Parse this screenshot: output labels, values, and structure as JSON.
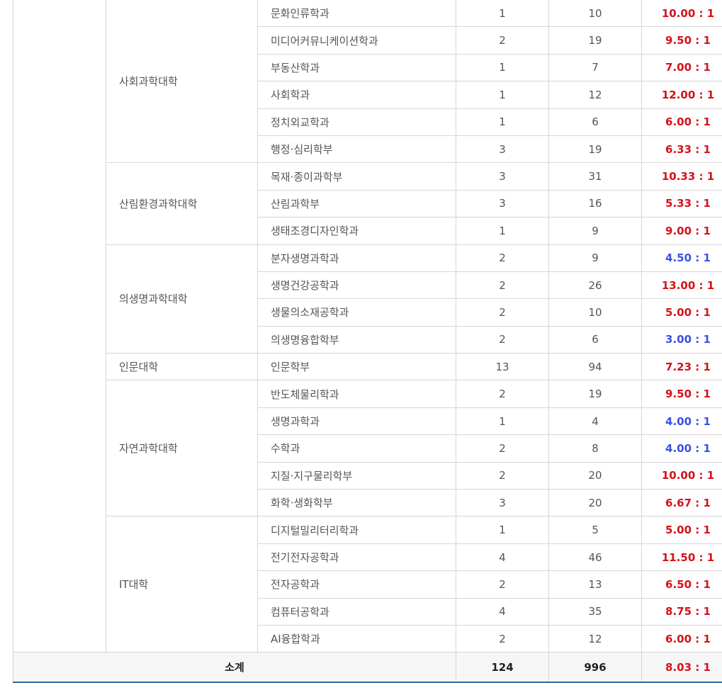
{
  "colors": {
    "high_ratio": "#d3121b",
    "low_ratio": "#3b50e6",
    "total_border": "#2f6aa0"
  },
  "rows": [
    {
      "college": "",
      "dept": "문화인류학과",
      "quota": "1",
      "applicants": "10",
      "ratio": "10.00 : 1",
      "level": "red"
    },
    {
      "college": "사회과학대학",
      "dept": "미디어커뮤니케이션학과",
      "quota": "2",
      "applicants": "19",
      "ratio": "9.50 : 1",
      "level": "red"
    },
    {
      "college": "",
      "dept": "부동산학과",
      "quota": "1",
      "applicants": "7",
      "ratio": "7.00 : 1",
      "level": "red"
    },
    {
      "college": "",
      "dept": "사회학과",
      "quota": "1",
      "applicants": "12",
      "ratio": "12.00 : 1",
      "level": "red"
    },
    {
      "college": "",
      "dept": "정치외교학과",
      "quota": "1",
      "applicants": "6",
      "ratio": "6.00 : 1",
      "level": "red"
    },
    {
      "college": "",
      "dept": "행정·심리학부",
      "quota": "3",
      "applicants": "19",
      "ratio": "6.33 : 1",
      "level": "red"
    },
    {
      "college": "산림환경과학대학",
      "dept": "목재·종이과학부",
      "quota": "3",
      "applicants": "31",
      "ratio": "10.33 : 1",
      "level": "red"
    },
    {
      "college": "",
      "dept": "산림과학부",
      "quota": "3",
      "applicants": "16",
      "ratio": "5.33 : 1",
      "level": "red"
    },
    {
      "college": "",
      "dept": "생태조경디자인학과",
      "quota": "1",
      "applicants": "9",
      "ratio": "9.00 : 1",
      "level": "red"
    },
    {
      "college": "의생명과학대학",
      "dept": "분자생명과학과",
      "quota": "2",
      "applicants": "9",
      "ratio": "4.50 : 1",
      "level": "blue"
    },
    {
      "college": "",
      "dept": "생명건강공학과",
      "quota": "2",
      "applicants": "26",
      "ratio": "13.00 : 1",
      "level": "red"
    },
    {
      "college": "",
      "dept": "생물의소재공학과",
      "quota": "2",
      "applicants": "10",
      "ratio": "5.00 : 1",
      "level": "red"
    },
    {
      "college": "",
      "dept": "의생명융합학부",
      "quota": "2",
      "applicants": "6",
      "ratio": "3.00 : 1",
      "level": "blue"
    },
    {
      "college": "인문대학",
      "dept": "인문학부",
      "quota": "13",
      "applicants": "94",
      "ratio": "7.23 : 1",
      "level": "red"
    },
    {
      "college": "자연과학대학",
      "dept": "반도체물리학과",
      "quota": "2",
      "applicants": "19",
      "ratio": "9.50 : 1",
      "level": "red"
    },
    {
      "college": "",
      "dept": "생명과학과",
      "quota": "1",
      "applicants": "4",
      "ratio": "4.00 : 1",
      "level": "blue"
    },
    {
      "college": "",
      "dept": "수학과",
      "quota": "2",
      "applicants": "8",
      "ratio": "4.00 : 1",
      "level": "blue"
    },
    {
      "college": "",
      "dept": "지질·지구물리학부",
      "quota": "2",
      "applicants": "20",
      "ratio": "10.00 : 1",
      "level": "red"
    },
    {
      "college": "",
      "dept": "화학·생화학부",
      "quota": "3",
      "applicants": "20",
      "ratio": "6.67 : 1",
      "level": "red"
    },
    {
      "college": "IT대학",
      "dept": "디지털밀리터리학과",
      "quota": "1",
      "applicants": "5",
      "ratio": "5.00 : 1",
      "level": "red"
    },
    {
      "college": "",
      "dept": "전기전자공학과",
      "quota": "4",
      "applicants": "46",
      "ratio": "11.50 : 1",
      "level": "red"
    },
    {
      "college": "",
      "dept": "전자공학과",
      "quota": "2",
      "applicants": "13",
      "ratio": "6.50 : 1",
      "level": "red"
    },
    {
      "college": "",
      "dept": "컴퓨터공학과",
      "quota": "4",
      "applicants": "35",
      "ratio": "8.75 : 1",
      "level": "red"
    },
    {
      "college": "",
      "dept": "AI융합학과",
      "quota": "2",
      "applicants": "12",
      "ratio": "6.00 : 1",
      "level": "red"
    }
  ],
  "total": {
    "label": "소계",
    "quota": "124",
    "applicants": "996",
    "ratio": "8.03 : 1"
  }
}
